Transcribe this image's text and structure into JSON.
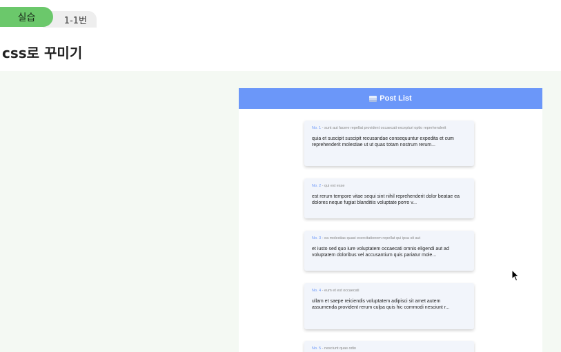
{
  "header": {
    "tag_label": "실습",
    "tag_sub_label": "1-1번",
    "title": "css로 꾸미기"
  },
  "frame": {
    "title": "Post List",
    "title_icon": "books-icon",
    "accent_color": "#6b97f9",
    "card_background": "#f2f5fb"
  },
  "posts": [
    {
      "number": "No. 1",
      "title": " - sunt aut facere repellat provident occaecati excepturi optio reprehenderit",
      "body": "quia et suscipit suscipit recusandae consequuntur expedita et cum reprehenderit molestiae ut ut quas totam nostrum rerum..."
    },
    {
      "number": "No. 2",
      "title": " - qui est esse",
      "body": "est rerum tempore vitae sequi sint nihil reprehenderit dolor beatae ea dolores neque fugiat blanditiis voluptate porro v..."
    },
    {
      "number": "No. 3",
      "title": " - ea molestias quasi exercitationem repellat qui ipsa sit aut",
      "body": "et iusto sed quo iure voluptatem occaecati omnis eligendi aut ad voluptatem doloribus vel accusantium quis pariatur mole..."
    },
    {
      "number": "No. 4",
      "title": " - eum et est occaecati",
      "body": "ullam et saepe reiciendis voluptatem adipisci sit amet autem assumenda provident rerum culpa quis hic commodi nesciunt r..."
    },
    {
      "number": "No. 5",
      "title": " - nesciunt quas odio",
      "body": ""
    }
  ]
}
